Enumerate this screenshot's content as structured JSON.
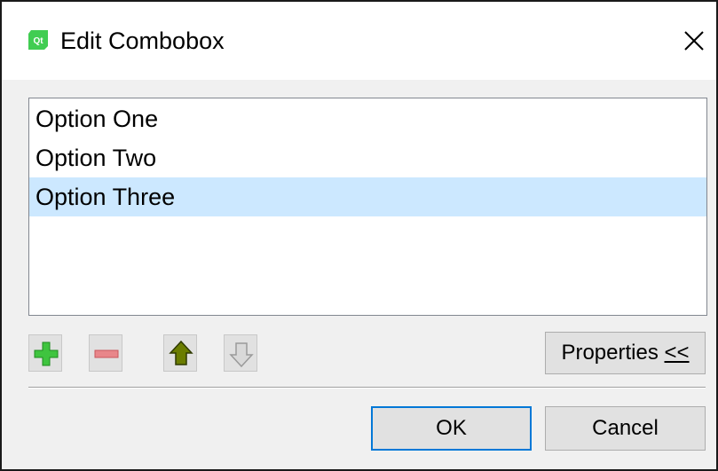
{
  "window": {
    "title": "Edit Combobox",
    "icon": "qt-logo-icon",
    "accent_color": "#41cd52"
  },
  "list": {
    "items": [
      {
        "label": "Option One",
        "selected": false
      },
      {
        "label": "Option Two",
        "selected": false
      },
      {
        "label": "Option Three",
        "selected": true
      }
    ],
    "selection_color": "#cce8ff"
  },
  "toolbar": {
    "buttons": [
      {
        "name": "add-item",
        "icon": "plus-icon",
        "enabled": true
      },
      {
        "name": "remove-item",
        "icon": "minus-icon",
        "enabled": true
      },
      {
        "name": "move-up",
        "icon": "arrow-up-icon",
        "enabled": true
      },
      {
        "name": "move-down",
        "icon": "arrow-down-icon",
        "enabled": false
      }
    ],
    "properties_label": "Properties ",
    "properties_toggle": "<<"
  },
  "footer": {
    "ok_label": "OK",
    "cancel_label": "Cancel"
  }
}
